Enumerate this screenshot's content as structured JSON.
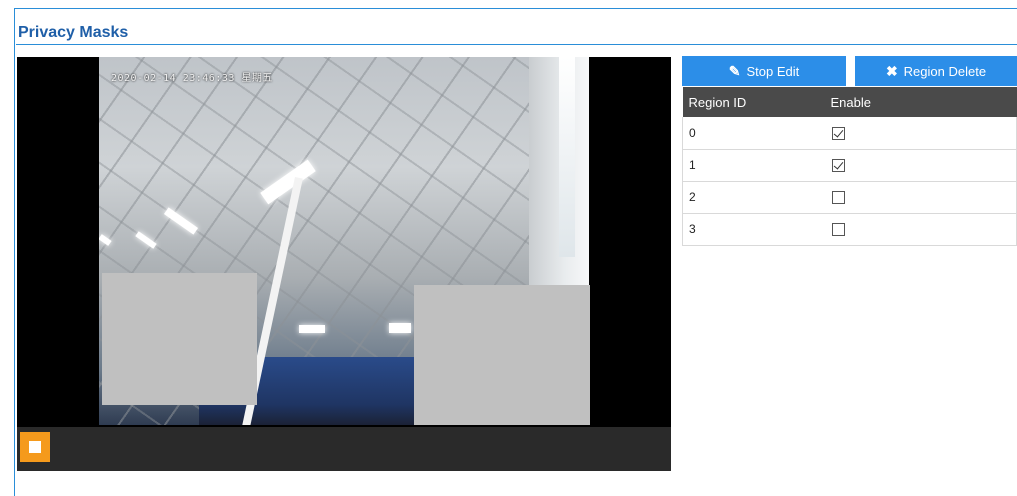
{
  "page": {
    "title": "Privacy Masks"
  },
  "video": {
    "osd_text": "2020-02-14 23:46:33 星期五",
    "masks": [
      {
        "id": "mask-0"
      },
      {
        "id": "mask-1"
      }
    ]
  },
  "toolbar": {
    "stop_edit_label": "Stop Edit",
    "stop_edit_icon": "pencil-icon",
    "region_delete_label": "Region Delete",
    "region_delete_icon": "x-icon"
  },
  "table": {
    "headers": [
      "Region ID",
      "Enable"
    ],
    "rows": [
      {
        "id": "0",
        "enabled": true
      },
      {
        "id": "1",
        "enabled": true
      },
      {
        "id": "2",
        "enabled": false
      },
      {
        "id": "3",
        "enabled": false
      }
    ]
  },
  "colors": {
    "accent": "#2c8ee8",
    "title": "#1f5fa8",
    "header_bg": "#4a4a4a",
    "stop_button": "#f59a1c",
    "mask": "#c0c0c0"
  }
}
